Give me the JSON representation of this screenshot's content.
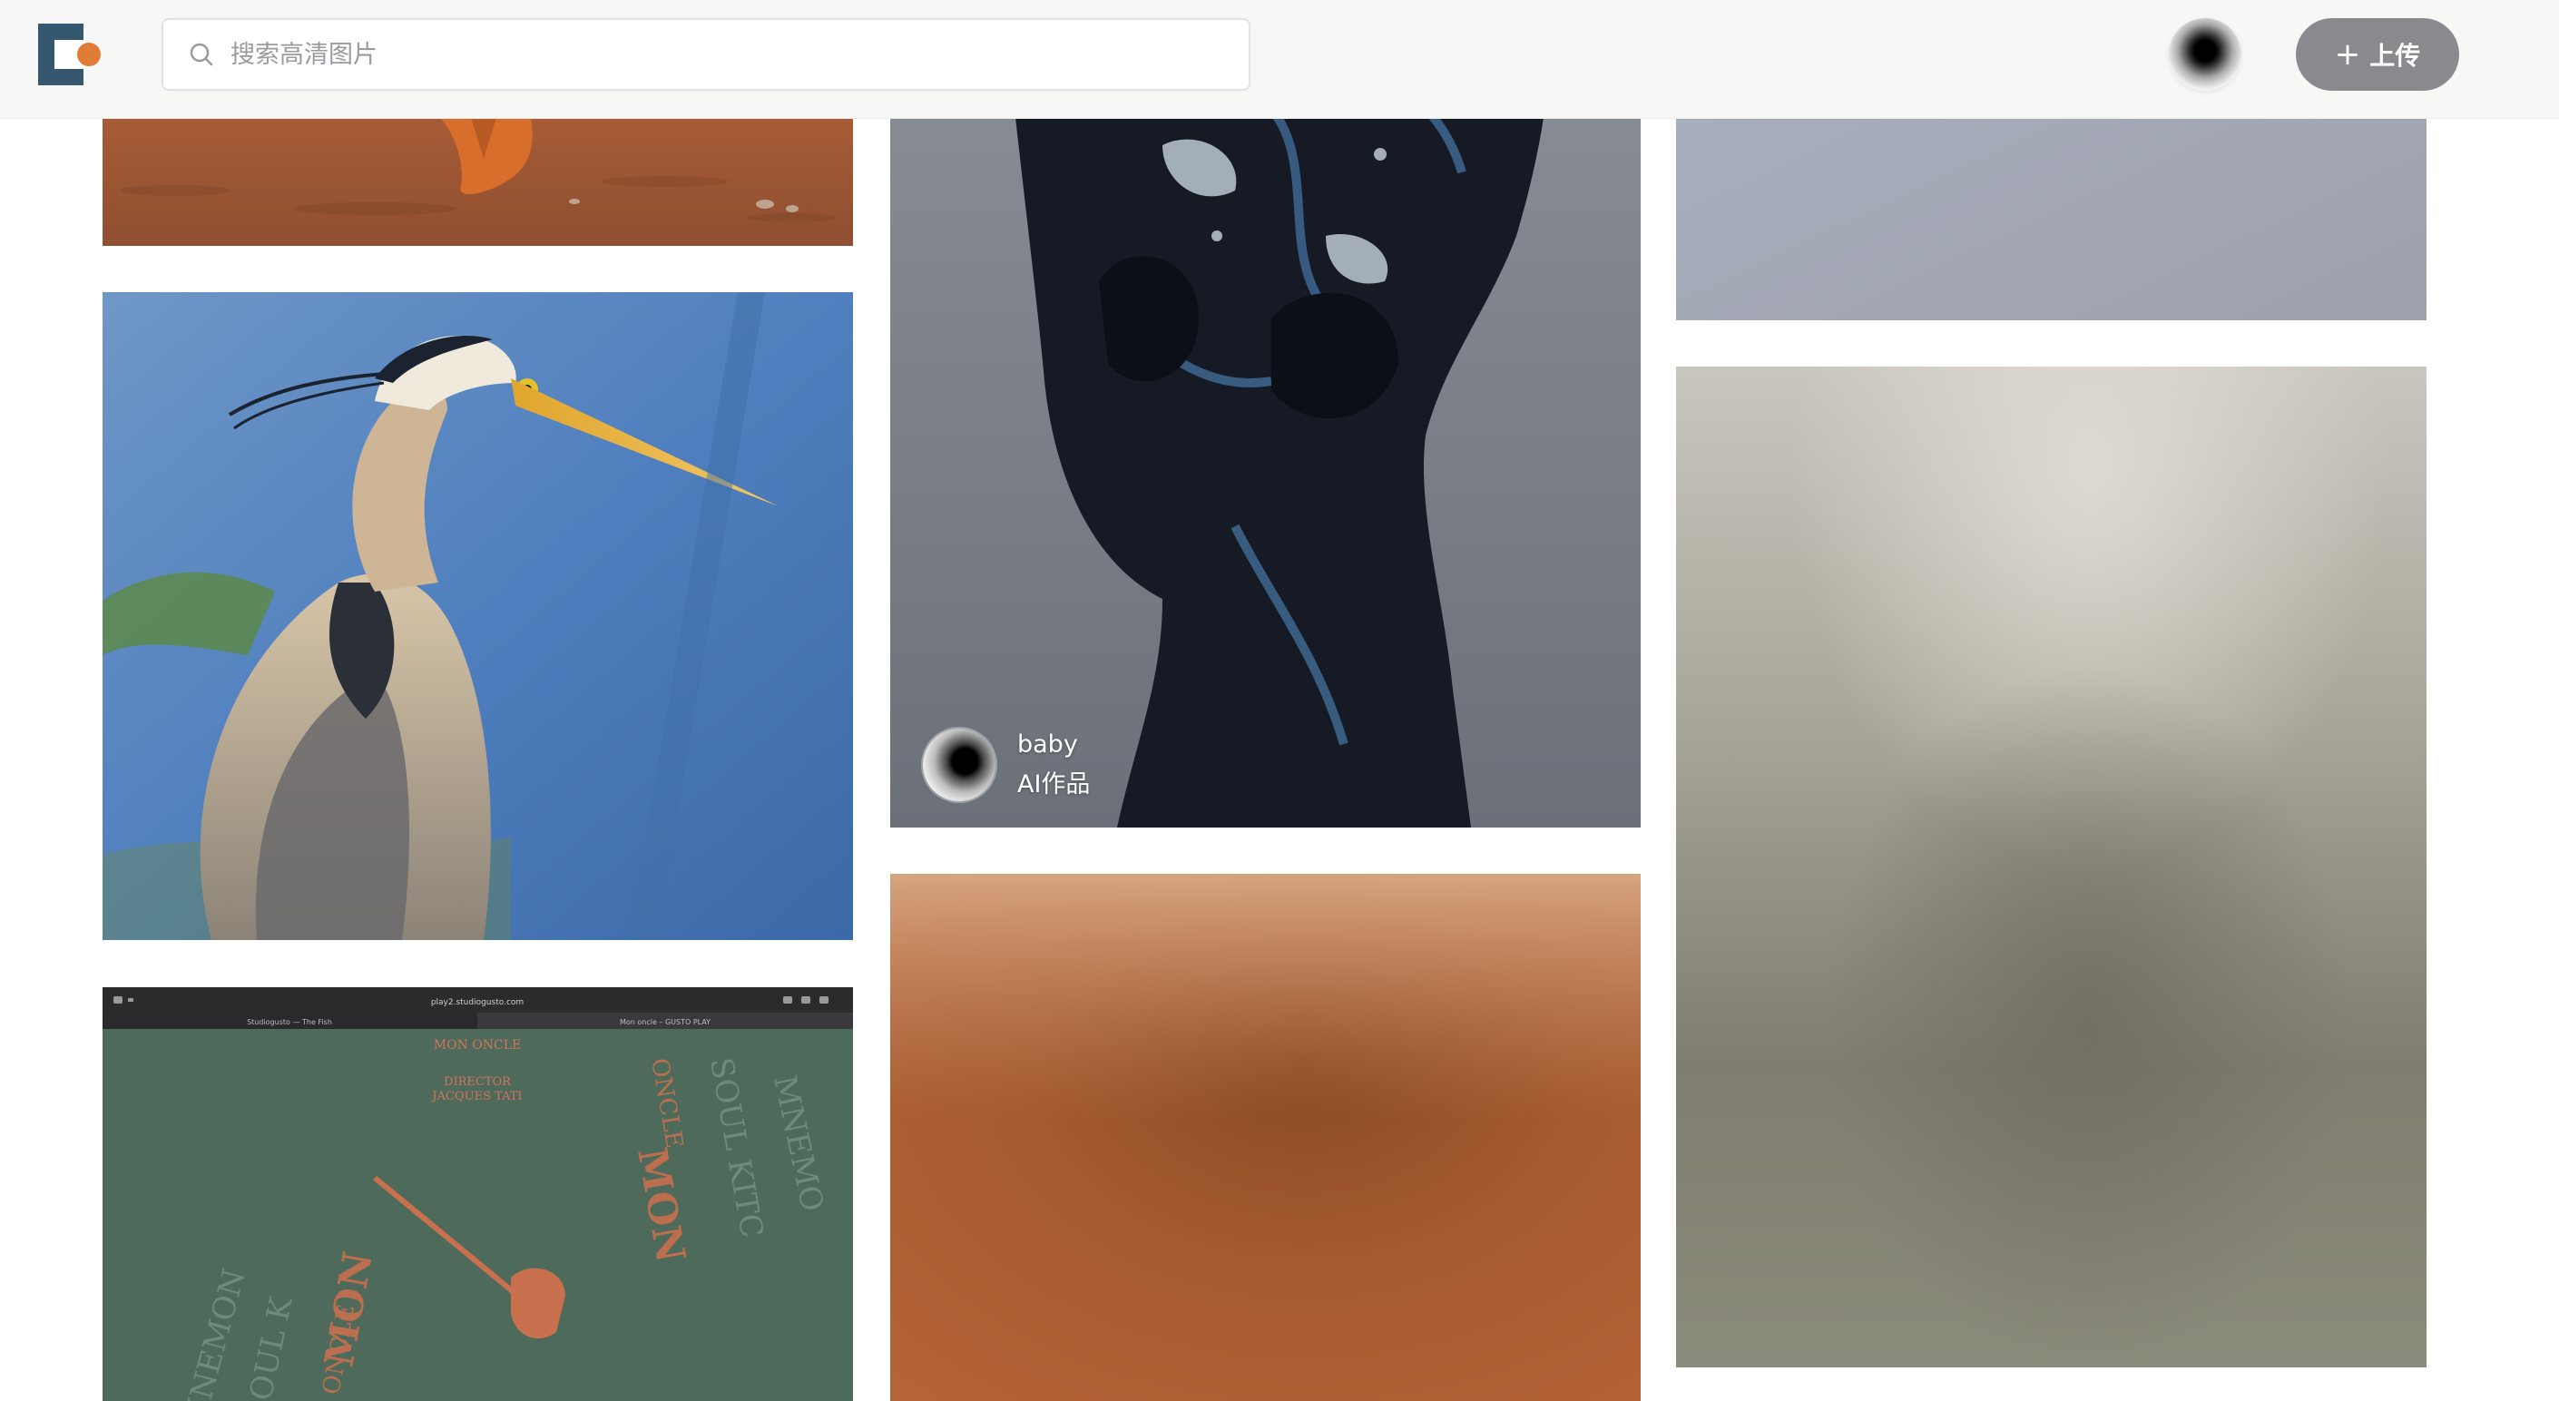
{
  "header": {
    "search": {
      "placeholder": "搜索高清图片"
    },
    "upload_button": {
      "icon": "plus-icon",
      "label": "上传"
    }
  },
  "gallery": {
    "sculpture_card": {
      "author": {
        "name": "baby",
        "tag": "AI作品"
      }
    },
    "mon_oncle_card": {
      "title": "MON ONCLE",
      "director_label": "DIRECTOR",
      "director_name": "JACQUES TATI",
      "url": "play2.studiogusto.com",
      "tab_1": "Studiogusto — The Fish",
      "tab_2": "Mon oncle – GUSTO PLAY"
    }
  }
}
